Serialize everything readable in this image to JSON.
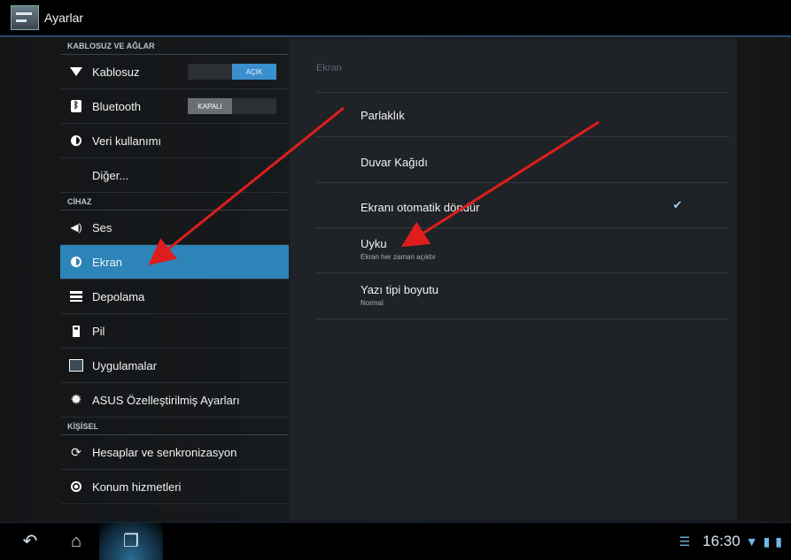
{
  "topbar": {
    "title": "Ayarlar"
  },
  "sections": {
    "wireless": "KABLOSUZ VE AĞLAR",
    "device": "CİHAZ",
    "personal": "KİŞİSEL"
  },
  "items": {
    "wifi": {
      "label": "Kablosuz",
      "toggle_on": "AÇIK"
    },
    "bluetooth": {
      "label": "Bluetooth",
      "toggle_off": "KAPALI"
    },
    "data": {
      "label": "Veri kullanımı"
    },
    "more": {
      "label": "Diğer..."
    },
    "sound": {
      "label": "Ses"
    },
    "display": {
      "label": "Ekran"
    },
    "storage": {
      "label": "Depolama"
    },
    "battery": {
      "label": "Pil"
    },
    "apps": {
      "label": "Uygulamalar"
    },
    "asus": {
      "label": "ASUS Özelleştirilmiş Ayarları"
    },
    "accounts": {
      "label": "Hesaplar ve senkronizasyon"
    },
    "location": {
      "label": "Konum hizmetleri"
    }
  },
  "panel": {
    "title": "Ekran",
    "brightness": "Parlaklık",
    "wallpaper": "Duvar Kağıdı",
    "autorotate": "Ekranı otomatik döndür",
    "autorotate_checked": true,
    "sleep": "Uyku",
    "sleep_sub": "Ekran her zaman açıktır",
    "fontsize": "Yazı tipi boyutu",
    "fontsize_sub": "Normal"
  },
  "navbar": {
    "clock": "16:30"
  },
  "colors": {
    "accent": "#2d84b8",
    "annotation": "#e01d1d"
  }
}
